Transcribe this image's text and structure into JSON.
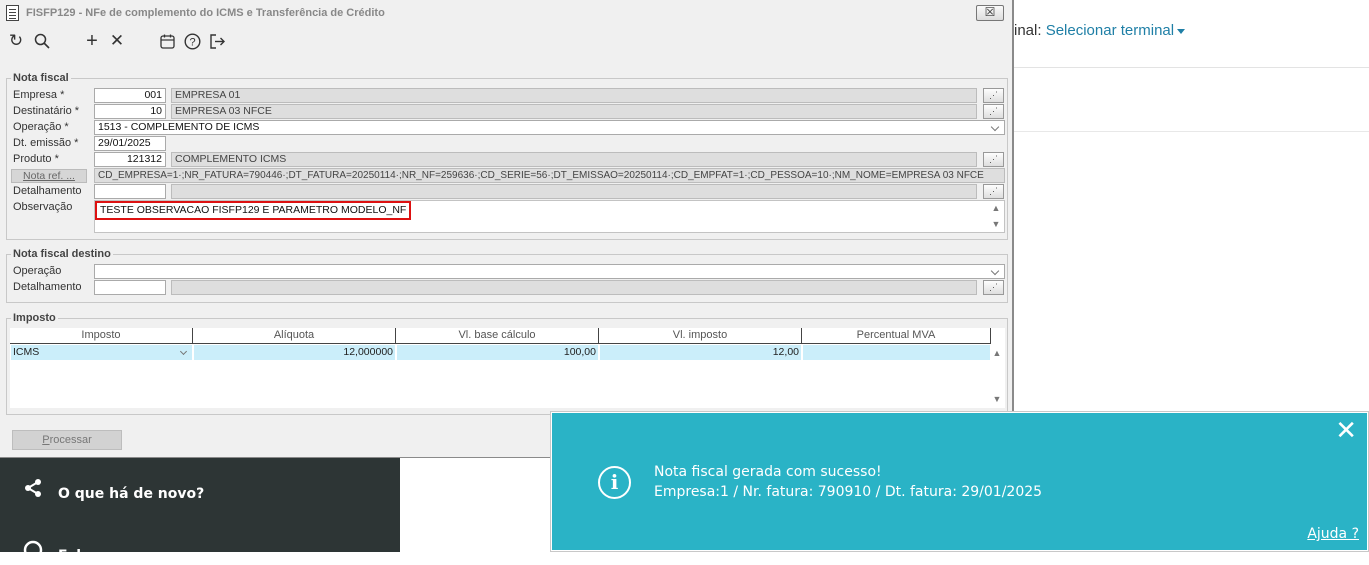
{
  "background": {
    "terminal_prefix": "inal:",
    "terminal_link": "Selecionar terminal",
    "sidebar": [
      {
        "icon": "share-icon",
        "label": "O que há de novo?"
      },
      {
        "icon": "help-circle-icon",
        "label": "Fale conosco"
      }
    ]
  },
  "window": {
    "title": "FISFP129 - NFe de complemento do ICMS e Transferência de Crédito",
    "close_glyph": "☒",
    "toolbar": [
      {
        "name": "refresh-icon",
        "glyph": "↻"
      },
      {
        "name": "search-icon",
        "glyph": "⚲"
      },
      {
        "name": "add-icon",
        "glyph": "+"
      },
      {
        "name": "delete-icon",
        "glyph": "✕"
      },
      {
        "name": "calendar-icon",
        "glyph": "▦"
      },
      {
        "name": "help-icon",
        "glyph": "?"
      },
      {
        "name": "exit-icon",
        "glyph": "⇥"
      }
    ]
  },
  "nota_fiscal": {
    "legend": "Nota fiscal",
    "empresa_label": "Empresa *",
    "empresa_code": "001",
    "empresa_name": "EMPRESA 01",
    "destinatario_label": "Destinatário *",
    "destinatario_code": "10",
    "destinatario_name": "EMPRESA 03 NFCE",
    "operacao_label": "Operação *",
    "operacao_value": "1513 - COMPLEMENTO DE ICMS",
    "dt_emissao_label": "Dt. emissão *",
    "dt_emissao_value": "29/01/2025",
    "produto_label": "Produto *",
    "produto_code": "121312",
    "produto_name": "COMPLEMENTO ICMS",
    "nota_ref_button": "Nota ref. ...",
    "nota_ref_value": "CD_EMPRESA=1·;NR_FATURA=790446·;DT_FATURA=20250114·;NR_NF=259636·;CD_SERIE=56·;DT_EMISSAO=20250114·;CD_EMPFAT=1·;CD_PESSOA=10·;NM_NOME=EMPRESA 03 NFCE",
    "detalhamento_label": "Detalhamento",
    "detalhamento_code": "",
    "detalhamento_name": "",
    "observacao_label": "Observação",
    "observacao_value": "TESTE OBSERVACAO FISFP129 E PARAMETRO MODELO_NF"
  },
  "nota_destino": {
    "legend": "Nota fiscal destino",
    "operacao_label": "Operação",
    "operacao_value": "",
    "detalhamento_label": "Detalhamento",
    "detalhamento_code": "",
    "detalhamento_name": ""
  },
  "imposto": {
    "legend": "Imposto",
    "columns": [
      "Imposto",
      "Alíquota",
      "Vl. base cálculo",
      "Vl. imposto",
      "Percentual MVA"
    ],
    "row": [
      "ICMS",
      "12,000000",
      "100,00",
      "12,00",
      ""
    ]
  },
  "processar_label_u": "P",
  "processar_label_rest": "rocessar",
  "toast": {
    "close_glyph": "✕",
    "info_glyph": "i",
    "line1": "Nota fiscal gerada com sucesso!",
    "line2": "Empresa:1 / Nr. fatura: 790910 / Dt. fatura: 29/01/2025",
    "help": "Ajuda ?"
  }
}
